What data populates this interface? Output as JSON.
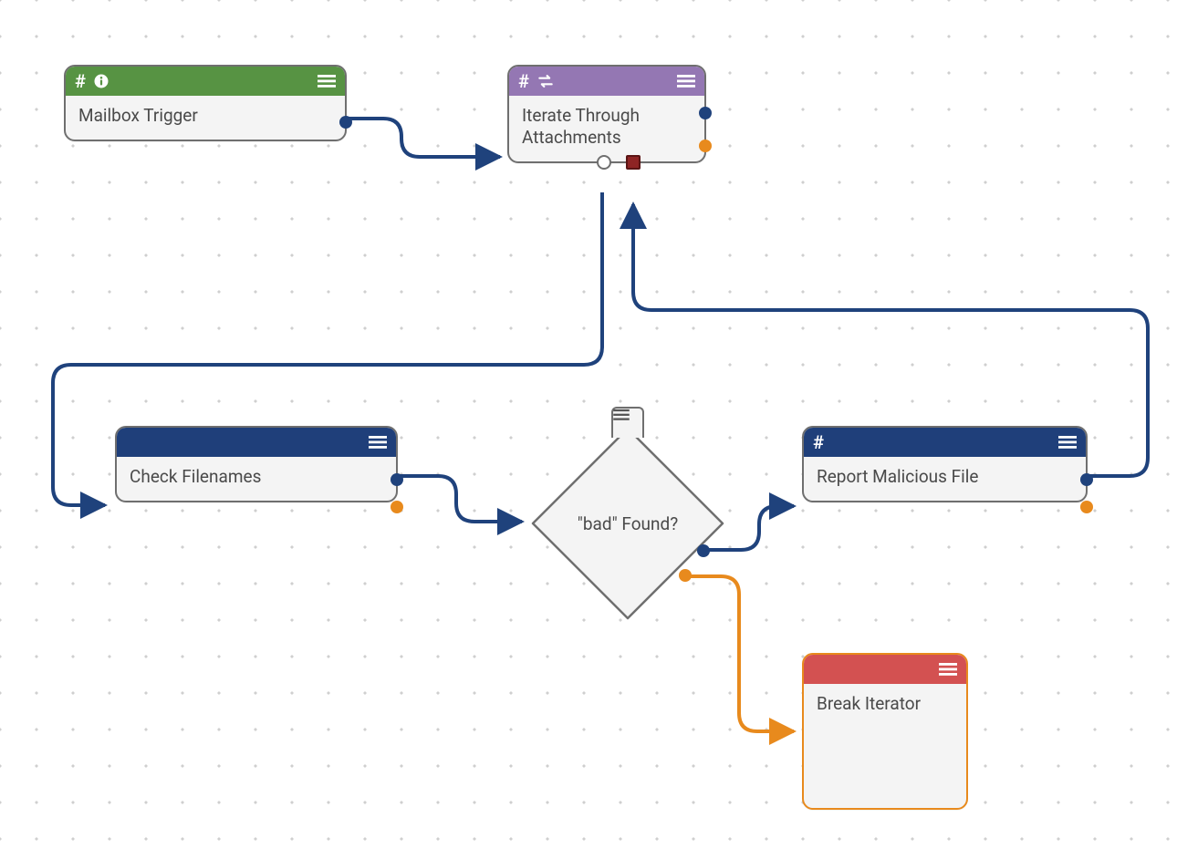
{
  "colors": {
    "green": "#579343",
    "purple": "#9477b3",
    "navy": "#1f3f7a",
    "red": "#d35151",
    "orange": "#e88a1d",
    "edgeBlue": "#1f427c",
    "edgeOrange": "#e88a1d"
  },
  "nodes": {
    "mailboxTrigger": {
      "title": "Mailbox Trigger",
      "headerColor": "green",
      "hasHash": true,
      "hasInfo": true,
      "hasLoop": false
    },
    "iterateAttachments": {
      "title": "Iterate Through Attachments",
      "headerColor": "purple",
      "hasHash": true,
      "hasInfo": false,
      "hasLoop": true
    },
    "checkFilenames": {
      "title": "Check Filenames",
      "headerColor": "navy",
      "hasHash": false,
      "hasInfo": false,
      "hasLoop": false
    },
    "reportMalicious": {
      "title": "Report Malicious File",
      "headerColor": "navy",
      "hasHash": true,
      "hasInfo": false,
      "hasLoop": false
    },
    "breakIterator": {
      "title": "Break Iterator",
      "headerColor": "red",
      "hasHash": false,
      "hasInfo": false,
      "hasLoop": false
    }
  },
  "decision": {
    "label": "\"bad\" Found?"
  }
}
